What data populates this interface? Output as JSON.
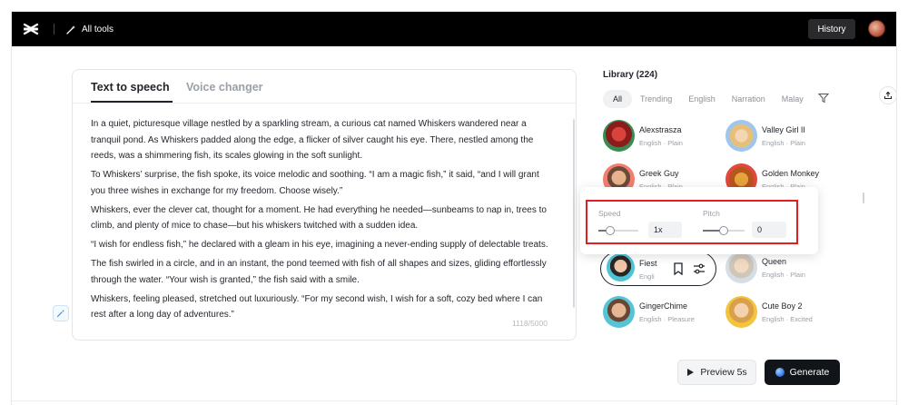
{
  "topbar": {
    "all_tools": "All tools",
    "history": "History"
  },
  "editor": {
    "tabs": [
      {
        "label": "Text to speech",
        "active": true
      },
      {
        "label": "Voice changer",
        "active": false
      }
    ],
    "paragraphs": [
      "In a quiet, picturesque village nestled by a sparkling stream, a curious cat named Whiskers wandered near a tranquil pond. As Whiskers padded along the edge, a flicker of silver caught his eye. There, nestled among the reeds, was a shimmering fish, its scales glowing in the soft sunlight.",
      "To Whiskers’ surprise, the fish spoke, its voice melodic and soothing. “I am a magic fish,” it said, “and I will grant you three wishes in exchange for my freedom. Choose wisely.”",
      "Whiskers, ever the clever cat, thought for a moment. He had everything he needed—sunbeams to nap in, trees to climb, and plenty of mice to chase—but his whiskers twitched with a sudden idea.",
      "“I wish for endless fish,” he declared with a gleam in his eye, imagining a never-ending supply of delectable treats.",
      "The fish swirled in a circle, and in an instant, the pond teemed with fish of all shapes and sizes, gliding effortlessly through the water. “Your wish is granted,” the fish said with a smile.",
      "Whiskers, feeling pleased, stretched out luxuriously. “For my second wish, I wish for a soft, cozy bed where I can rest after a long day of adventures.”"
    ],
    "char_count": "1118/5000"
  },
  "library": {
    "title": "Library (224)",
    "filters": [
      "All",
      "Trending",
      "English",
      "Narration",
      "Malay"
    ],
    "voices": [
      {
        "name": "Alexstrasza",
        "meta": "English · Plain"
      },
      {
        "name": "Valley Girl II",
        "meta": "English · Plain"
      },
      {
        "name": "Greek Guy",
        "meta": "English · Plain"
      },
      {
        "name": "Golden Monkey",
        "meta": "English · Plain"
      },
      {
        "name": "Fiest",
        "meta": "Engli"
      },
      {
        "name": "Queen",
        "meta": "English · Plain"
      },
      {
        "name": "GingerChime",
        "meta": "English · Pleasure"
      },
      {
        "name": "Cute Boy 2",
        "meta": "English · Excited"
      }
    ]
  },
  "popup": {
    "speed": {
      "label": "Speed",
      "value": "1x",
      "level": 0.3
    },
    "pitch": {
      "label": "Pitch",
      "value": "0",
      "level": 0.5
    }
  },
  "actions": {
    "preview": "Preview 5s",
    "generate": "Generate"
  },
  "colors": {
    "topbar": "#000000",
    "highlight": "#e02020",
    "generate_bg": "#111418"
  }
}
